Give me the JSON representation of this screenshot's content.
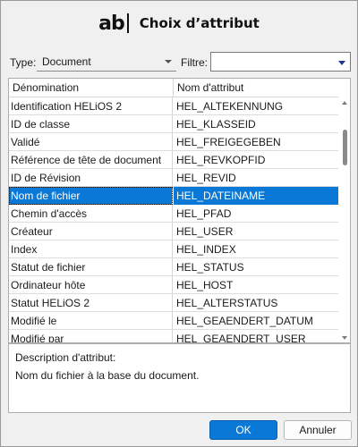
{
  "dialog": {
    "app_icon_text": "ab",
    "title": "Choix d’attribut"
  },
  "filters": {
    "type_label": "Type:",
    "type_value": "Document",
    "filter_label": "Filtre:",
    "filter_value": ""
  },
  "table": {
    "columns": [
      "Dénomination",
      "Nom d'attribut"
    ],
    "rows": [
      {
        "name": "Identification HELiOS 2",
        "attr": "HEL_ALTEKENNUNG"
      },
      {
        "name": "ID de classe",
        "attr": "HEL_KLASSEID"
      },
      {
        "name": "Validé",
        "attr": "HEL_FREIGEGEBEN"
      },
      {
        "name": "Référence de tête de document",
        "attr": "HEL_REVKOPFID"
      },
      {
        "name": "ID de Révision",
        "attr": "HEL_REVID"
      },
      {
        "name": "Nom de fichier",
        "attr": "HEL_DATEINAME"
      },
      {
        "name": "Chemin d'accès",
        "attr": "HEL_PFAD"
      },
      {
        "name": "Créateur",
        "attr": "HEL_USER"
      },
      {
        "name": "Index",
        "attr": "HEL_INDEX"
      },
      {
        "name": "Statut de fichier",
        "attr": "HEL_STATUS"
      },
      {
        "name": "Ordinateur hôte",
        "attr": "HEL_HOST"
      },
      {
        "name": "Statut HELiOS 2",
        "attr": "HEL_ALTERSTATUS"
      },
      {
        "name": "Modifié le",
        "attr": "HEL_GEAENDERT_DATUM"
      },
      {
        "name": "Modifié par",
        "attr": "HEL_GEAENDERT_USER"
      }
    ],
    "selected_row": 5,
    "selected_color": "#0a78d7"
  },
  "description": {
    "title": "Description d'attribut:",
    "text": "Nom du fichier à la base du document."
  },
  "buttons": {
    "ok": "OK",
    "cancel": "Annuler"
  }
}
